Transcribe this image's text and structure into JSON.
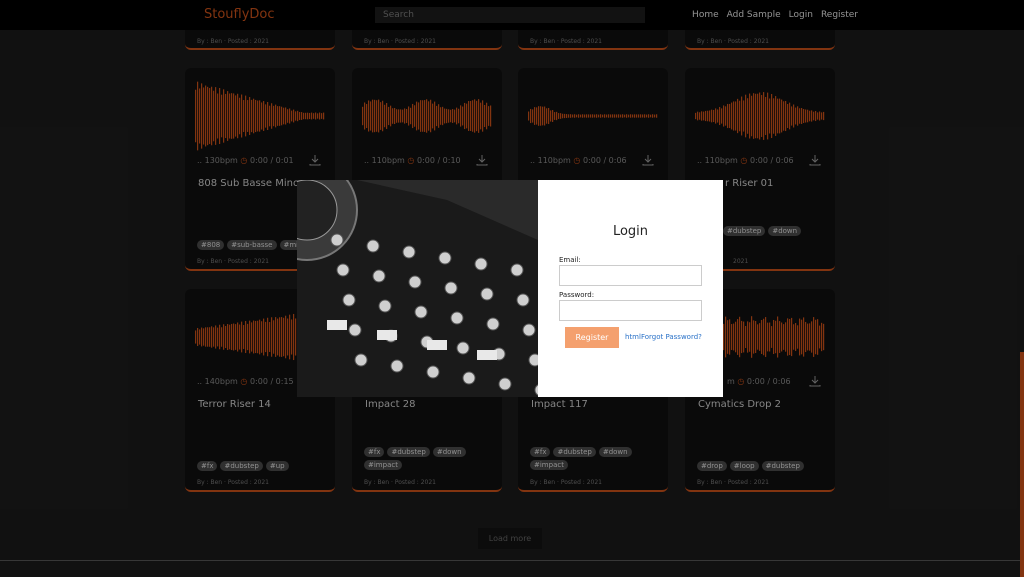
{
  "nav": {
    "logo": "StouflyDoc",
    "search_placeholder": "Search",
    "links": [
      "Home",
      "Add Sample",
      "Login",
      "Register"
    ]
  },
  "cards_top": [
    {
      "posted": "By : Ben · Posted : 2021"
    },
    {
      "posted": "By : Ben · Posted : 2021"
    },
    {
      "posted": "By : Ben · Posted : 2021"
    },
    {
      "posted": "By : Ben · Posted : 2021"
    }
  ],
  "cards": [
    {
      "bpm": ".. 130bpm",
      "time": "0:00 / 0:01",
      "title": "808 Sub Basse Mino",
      "tags": [
        "#808",
        "#sub-basse",
        "#mi"
      ],
      "posted": "By : Ben · Posted : 2021"
    },
    {
      "bpm": ".. 110bpm",
      "time": "0:00 / 0:10",
      "title": "",
      "tags": [],
      "posted": ""
    },
    {
      "bpm": ".. 110bpm",
      "time": "0:00 / 0:06",
      "title": "",
      "tags": [],
      "posted": ""
    },
    {
      "bpm": ".. 110bpm",
      "time": "0:00 / 0:06",
      "title": "r Riser 01",
      "tags": [
        "#dubstep",
        "#down"
      ],
      "posted": "2021"
    },
    {
      "bpm": ".. 140bpm",
      "time": "0:00 / 0:15",
      "title": "Terror Riser 14",
      "tags": [
        "#fx",
        "#dubstep",
        "#up"
      ],
      "posted": "By : Ben · Posted : 2021"
    },
    {
      "bpm": "",
      "time": "",
      "title": "Impact 28",
      "tags": [
        "#fx",
        "#dubstep",
        "#down",
        "#impact"
      ],
      "posted": "By : Ben · Posted : 2021"
    },
    {
      "bpm": "",
      "time": "",
      "title": "Impact 117",
      "tags": [
        "#fx",
        "#dubstep",
        "#down",
        "#impact"
      ],
      "posted": "By : Ben · Posted : 2021"
    },
    {
      "bpm": "m",
      "time": "0:00 / 0:06",
      "title": "Cymatics Drop 2",
      "tags": [
        "#drop",
        "#loop",
        "#dubstep"
      ],
      "posted": "By : Ben · Posted : 2021"
    }
  ],
  "load_more": "Load more",
  "modal": {
    "title": "Login",
    "email_label": "Email:",
    "password_label": "Password:",
    "register_label": "Register",
    "forgot_label": "htmlForgot Password?"
  },
  "colors": {
    "accent": "#c8501a",
    "link": "#2a72c8",
    "button": "#f4a06e"
  }
}
